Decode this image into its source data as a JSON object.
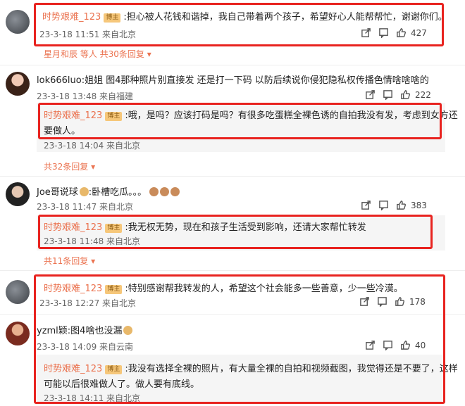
{
  "comments": [
    {
      "user": "时势艰难_123",
      "badge": "博主",
      "text": ":担心被人花钱和谐掉，我自己带着两个孩子，希望好心人能帮帮忙，谢谢你们。",
      "meta": "23-3-18 11:51 来自北京",
      "likes": "427",
      "more": "星月和辰 等人 共30条回复 ▾"
    },
    {
      "user": "lok666luo",
      "text": ":姐姐 图4那种照片别直接发 还是打一下码 以防后续说你侵犯隐私权传播色情啥啥啥的",
      "meta": "23-3-18 13:48 来自福建",
      "likes": "222",
      "reply": {
        "user": "时势艰难_123",
        "badge": "博主",
        "text1": ":哦，是吗？应该打码是吗？有很多吃蛋糕全裸色诱的自拍我没有发，考虑到女方还",
        "text2": "要做人。",
        "meta": "23-3-18 14:04 来自北京"
      },
      "more": "共32条回复 ▾"
    },
    {
      "user": "Joe哥说球",
      "text": ":卧槽吃瓜。。。",
      "meta": "23-3-18 11:47 来自北京",
      "likes": "383",
      "reply": {
        "user": "时势艰难_123",
        "badge": "博主",
        "text": ":我无权无势，现在和孩子生活受到影响，还请大家帮忙转发",
        "meta": "23-3-18 11:48 来自北京"
      },
      "more": "共11条回复 ▾"
    },
    {
      "user": "时势艰难_123",
      "badge": "博主",
      "text": ":特别感谢帮我转发的人，希望这个社会能多一些善意，少一些冷漠。",
      "meta": "23-3-18 12:27 来自北京",
      "likes": "178"
    },
    {
      "user": "yzml颖",
      "text": ":图4啥也没漏",
      "meta": "23-3-18 14:09 来自云南",
      "likes": "40",
      "reply": {
        "user": "时势艰难_123",
        "badge": "博主",
        "text1": ":我没有选择全裸的照片，有大量全裸的自拍和视频截图，我觉得还是不要了，这样",
        "text2": "可能以后很难做人了。做人要有底线。",
        "meta": "23-3-18 14:11 来自北京"
      }
    }
  ],
  "colors": {
    "highlight": "#e8231f",
    "name": "#eb7350",
    "badge": "#f6c77a"
  },
  "icons": [
    "share-icon",
    "comment-icon",
    "like-icon"
  ]
}
